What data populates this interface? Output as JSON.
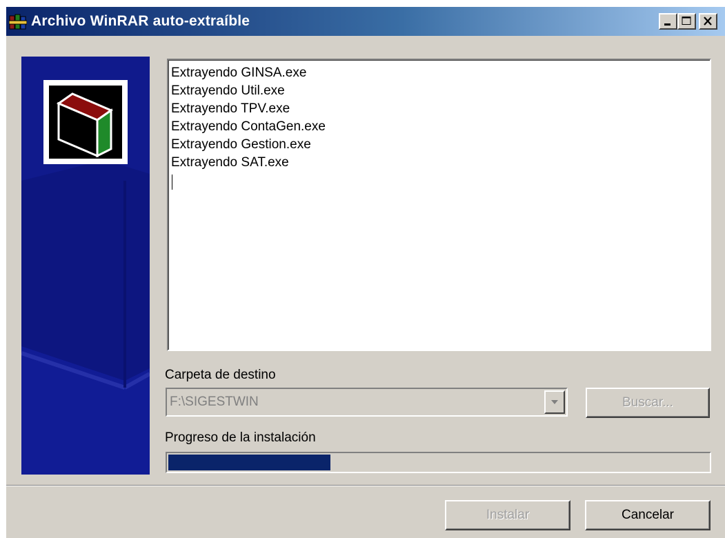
{
  "window": {
    "title": "Archivo WinRAR auto-extraíble"
  },
  "log": {
    "lines": [
      "Extrayendo GINSA.exe",
      "Extrayendo Util.exe",
      "Extrayendo TPV.exe",
      "Extrayendo ContaGen.exe",
      "Extrayendo Gestion.exe",
      "Extrayendo SAT.exe"
    ]
  },
  "destination": {
    "label": "Carpeta de destino",
    "value": "F:\\SIGESTWIN",
    "browse_label": "Buscar..."
  },
  "progress": {
    "label": "Progreso de la instalación",
    "fraction": 0.3
  },
  "buttons": {
    "install_label": "Instalar",
    "cancel_label": "Cancelar"
  },
  "icons": {
    "app": "winrar-books-icon",
    "logo": "winrar-box-logo-icon",
    "minimize": "minimize-icon",
    "maximize": "maximize-icon",
    "close": "close-icon",
    "dropdown": "chevron-down-icon"
  },
  "colors": {
    "face": "#d4d0c8",
    "titlebar_start": "#0a246a",
    "titlebar_end": "#a6caf0",
    "side_panel": "#0d1680",
    "progress_fill": "#0a246a"
  }
}
